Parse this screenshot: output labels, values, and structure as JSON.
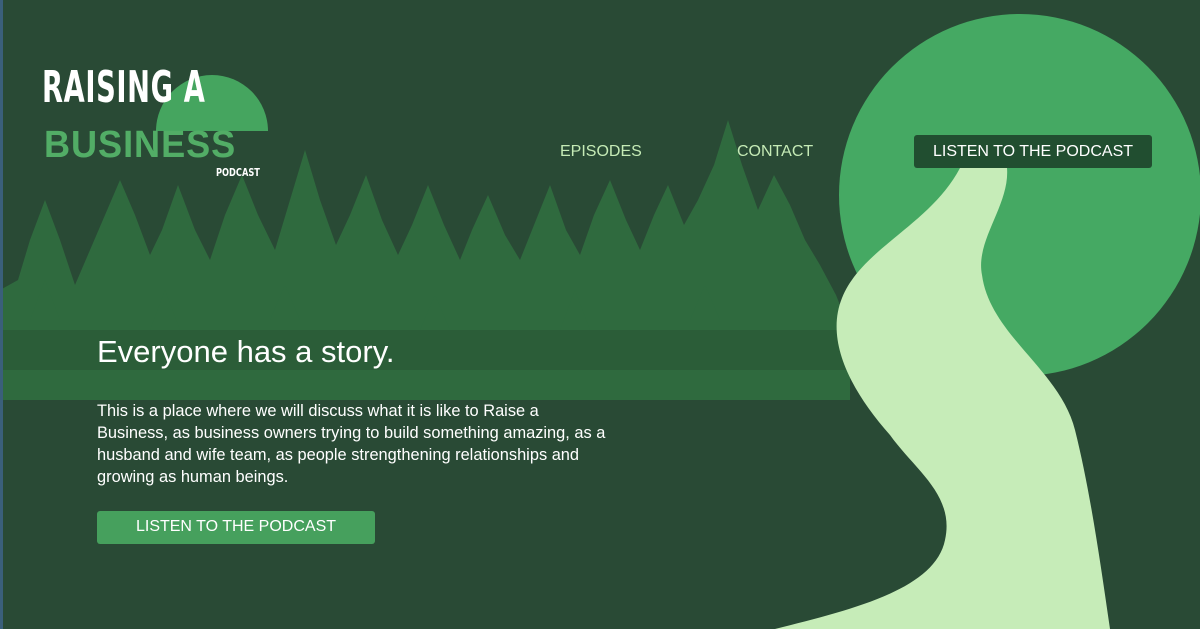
{
  "logo": {
    "line1": "RAISING A",
    "line2": "BUSINESS",
    "line3": "PODCAST"
  },
  "nav": {
    "items": [
      {
        "label": "EPISODES"
      },
      {
        "label": "CONTACT"
      }
    ],
    "cta_label": "LISTEN TO THE PODCAST"
  },
  "hero": {
    "title": "Everyone has a story.",
    "body": "This is a place where we will discuss what it is like to Raise a Business, as business owners trying to build something amazing, as a husband and wife team, as people strengthening relationships and growing as human beings.",
    "cta_label": "LISTEN TO THE PODCAST"
  },
  "colors": {
    "background": "#294a35",
    "trees": "#2f6a3e",
    "sun": "#45a963",
    "path": "#c6ecb8",
    "accent_button": "#46a05d",
    "nav_cta_background": "#214e30",
    "nav_link": "#c5ebb6",
    "text": "#ffffff"
  }
}
